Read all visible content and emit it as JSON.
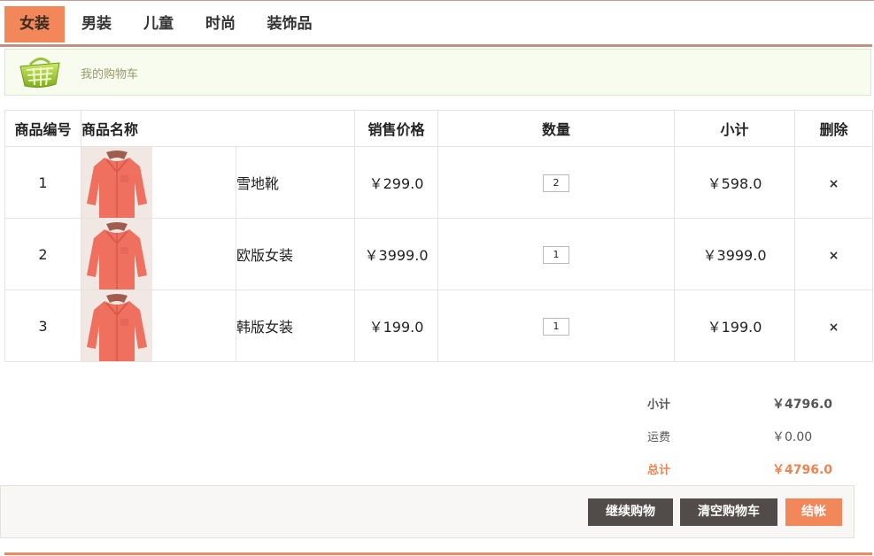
{
  "nav": {
    "items": [
      {
        "label": "女装",
        "active": true
      },
      {
        "label": "男装",
        "active": false
      },
      {
        "label": "儿童",
        "active": false
      },
      {
        "label": "时尚",
        "active": false
      },
      {
        "label": "装饰品",
        "active": false
      }
    ]
  },
  "banner": {
    "icon": "shopping-basket-icon",
    "title": "我的购物车"
  },
  "table": {
    "headers": {
      "id": "商品编号",
      "name": "商品名称",
      "price": "销售价格",
      "quantity": "数量",
      "subtotal": "小计",
      "delete": "删除"
    },
    "rows": [
      {
        "id": "1",
        "name": "雪地靴",
        "price": "￥299.0",
        "quantity": "2",
        "subtotal": "￥598.0",
        "delete": "×"
      },
      {
        "id": "2",
        "name": "欧版女装",
        "price": "￥3999.0",
        "quantity": "1",
        "subtotal": "￥3999.0",
        "delete": "×"
      },
      {
        "id": "3",
        "name": "韩版女装",
        "price": "￥199.0",
        "quantity": "1",
        "subtotal": "￥199.0",
        "delete": "×"
      }
    ]
  },
  "summary": {
    "subtotal_label": "小计",
    "subtotal_value": "￥4796.0",
    "shipping_label": "运费",
    "shipping_value": "￥0.00",
    "total_label": "总计",
    "total_value": "￥4796.0"
  },
  "actions": {
    "continue_label": "继续购物",
    "clear_label": "清空购物车",
    "checkout_label": "结帐"
  },
  "colors": {
    "accent": "#f2875a",
    "dark_button": "#514c49"
  }
}
